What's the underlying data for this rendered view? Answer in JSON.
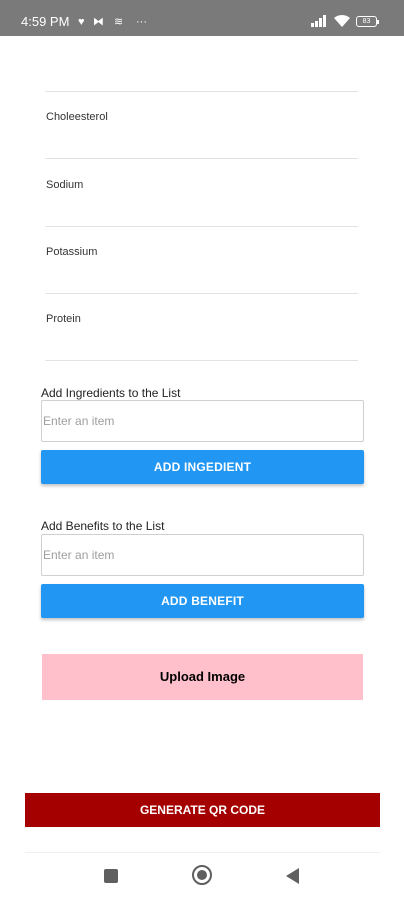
{
  "status_bar": {
    "time": "4:59 PM",
    "icons": [
      "heart-icon",
      "dual-sim-icon",
      "layers-icon",
      "more-icon"
    ],
    "battery": "83"
  },
  "nutrients": [
    {
      "label": "Choleesterol"
    },
    {
      "label": "Sodium"
    },
    {
      "label": "Potassium"
    },
    {
      "label": "Protein"
    }
  ],
  "ingredients": {
    "label": "Add Ingredients to the List",
    "placeholder": "Enter an item",
    "button": "ADD INGEDIENT"
  },
  "benefits": {
    "label": "Add Benefits to the List",
    "placeholder": "Enter an item",
    "button": "ADD BENEFIT"
  },
  "upload_button": "Upload Image",
  "generate_button": "GENERATE QR CODE",
  "colors": {
    "status_bar": "#7a7a7a",
    "primary": "#2196f3",
    "upload": "#ffc0cb",
    "generate": "#a50000"
  }
}
